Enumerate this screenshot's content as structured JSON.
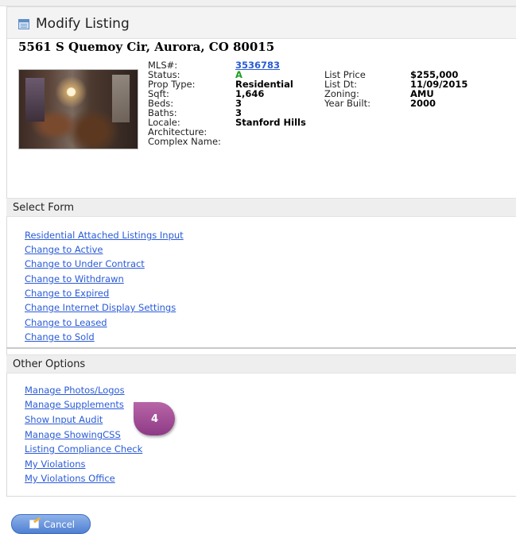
{
  "header": {
    "title": "Modify Listing"
  },
  "listing": {
    "address": "5561 S Quemoy Cir, Aurora, CO 80015",
    "photo_alt": "Listing photo",
    "fields_left": [
      {
        "label": "MLS#:",
        "value": "3536783"
      },
      {
        "label": "Status:",
        "value": "A"
      },
      {
        "label": "Prop Type:",
        "value": "Residential"
      },
      {
        "label": "Sqft:",
        "value": "1,646"
      },
      {
        "label": "Beds:",
        "value": "3"
      },
      {
        "label": "Baths:",
        "value": "3"
      },
      {
        "label": "Locale:",
        "value": "Stanford Hills"
      },
      {
        "label": "Architecture:",
        "value": ""
      },
      {
        "label": "Complex Name:",
        "value": ""
      }
    ],
    "fields_right": [
      {
        "label": "List Price",
        "value": "$255,000"
      },
      {
        "label": "List Dt:",
        "value": "11/09/2015"
      },
      {
        "label": "Zoning:",
        "value": "AMU"
      },
      {
        "label": "Year Built:",
        "value": "2000"
      }
    ]
  },
  "select_form": {
    "title": "Select Form",
    "links": [
      "Residential Attached Listings Input",
      "Change to Active",
      "Change to Under Contract",
      "Change to Withdrawn",
      "Change to Expired",
      "Change Internet Display Settings",
      "Change to Leased",
      "Change to Sold"
    ]
  },
  "other_options": {
    "title": "Other Options",
    "links": [
      "Manage Photos/Logos",
      "Manage Supplements",
      "Show Input Audit",
      "Manage ShowingCSS",
      "Listing Compliance Check",
      "My Violations",
      "My Violations Office"
    ]
  },
  "callout": {
    "number": "4"
  },
  "footer": {
    "cancel_label": "Cancel"
  },
  "colors": {
    "link": "#2a5bd7",
    "status_active": "#1e9e1e",
    "callout": "#9b4594",
    "button": "#5a8ad6"
  }
}
